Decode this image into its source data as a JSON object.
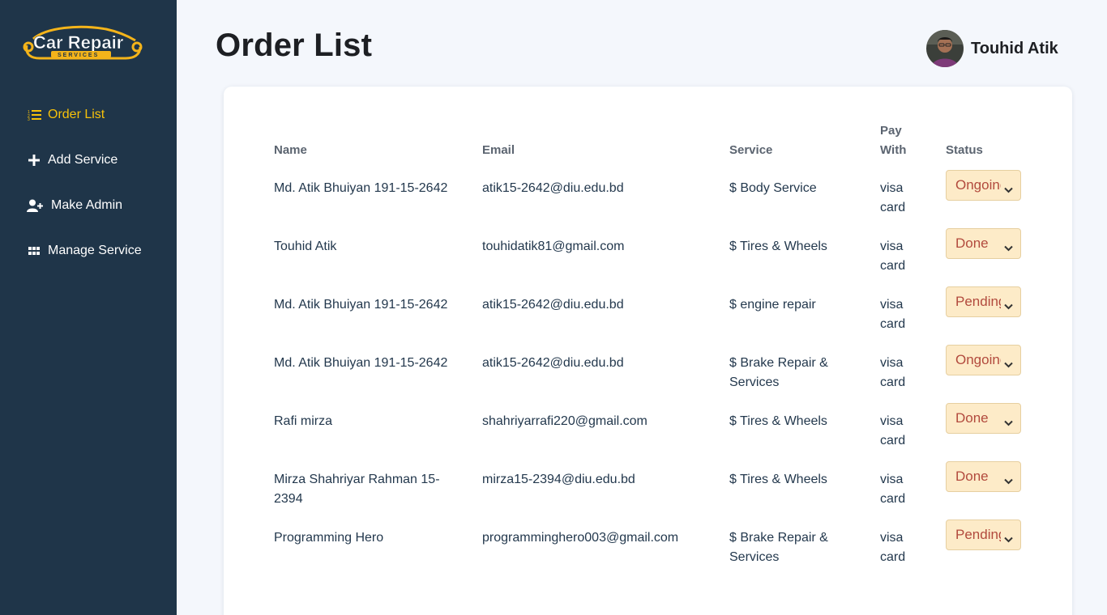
{
  "brand": {
    "logo_text": "Car Repair",
    "logo_subtext": "SERVICES"
  },
  "sidebar": {
    "items": [
      {
        "label": "Order List",
        "icon": "list-icon",
        "active": true
      },
      {
        "label": "Add Service",
        "icon": "plus-icon",
        "active": false
      },
      {
        "label": "Make Admin",
        "icon": "user-plus-icon",
        "active": false
      },
      {
        "label": "Manage Service",
        "icon": "grid-icon",
        "active": false
      }
    ]
  },
  "header": {
    "title": "Order List",
    "user_name": "Touhid Atik"
  },
  "table": {
    "headers": {
      "name": "Name",
      "email": "Email",
      "service": "Service",
      "pay_line1": "Pay",
      "pay_line2": "With",
      "status": "Status"
    },
    "rows": [
      {
        "name": "Md. Atik Bhuiyan 191-15-2642",
        "email": "atik15-2642@diu.edu.bd",
        "service": "$ Body Service",
        "pay1": "visa",
        "pay2": "card",
        "status": "Ongoing"
      },
      {
        "name": "Touhid Atik",
        "email": "touhidatik81@gmail.com",
        "service": "$ Tires & Wheels",
        "pay1": "visa",
        "pay2": "card",
        "status": "Done"
      },
      {
        "name": "Md. Atik Bhuiyan 191-15-2642",
        "email": "atik15-2642@diu.edu.bd",
        "service": "$ engine repair",
        "pay1": "visa",
        "pay2": "card",
        "status": "Pending"
      },
      {
        "name": "Md. Atik Bhuiyan 191-15-2642",
        "email": "atik15-2642@diu.edu.bd",
        "service": "$ Brake Repair & Services",
        "pay1": "visa",
        "pay2": "card",
        "status": "Ongoing"
      },
      {
        "name": "Rafi mirza",
        "email": "shahriyarrafi220@gmail.com",
        "service": "$ Tires & Wheels",
        "pay1": "visa",
        "pay2": "card",
        "status": "Done"
      },
      {
        "name": "Mirza Shahriyar Rahman 15-2394",
        "email": "mirza15-2394@diu.edu.bd",
        "service": "$ Tires & Wheels",
        "pay1": "visa",
        "pay2": "card",
        "status": "Done"
      },
      {
        "name": "Programming Hero",
        "email": "programminghero003@gmail.com",
        "service": "$ Brake Repair & Services",
        "pay1": "visa",
        "pay2": "card",
        "status": "Pending"
      }
    ]
  },
  "colors": {
    "sidebar_bg": "#1f3549",
    "active_nav": "#f6c10a",
    "status_bg": "#fdebc8",
    "status_text": "#b24a3d"
  }
}
